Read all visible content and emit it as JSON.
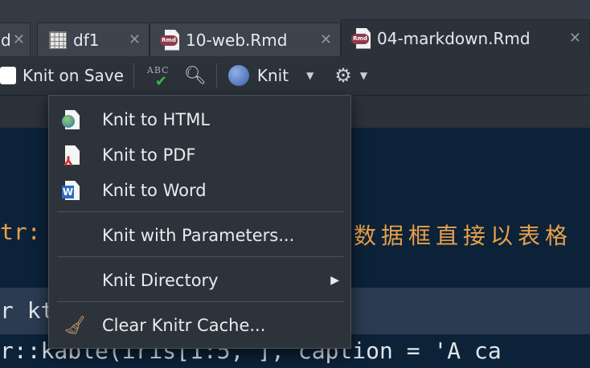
{
  "tabs": [
    {
      "label": "d",
      "icon": "none"
    },
    {
      "label": "df1",
      "icon": "grid-icon"
    },
    {
      "label": "10-web.Rmd",
      "icon": "rmd-file-icon"
    },
    {
      "label": "04-markdown.Rmd",
      "icon": "rmd-file-icon",
      "active": true
    }
  ],
  "tab_icon_badge": "Rmd",
  "toolbar": {
    "knit_on_save": "Knit on Save",
    "spell_text": "ABC",
    "knit": "Knit"
  },
  "editor": {
    "line1_prefix": "tr:",
    "line1_chinese": "数据框直接以表格",
    "line2": "r kt",
    "line3": "r::kable(iris[1:5, ], caption = 'A ca"
  },
  "menu": {
    "items": [
      {
        "label": "Knit to HTML",
        "icon": "html-globe-icon"
      },
      {
        "label": "Knit to PDF",
        "icon": "pdf-icon"
      },
      {
        "label": "Knit to Word",
        "icon": "word-icon"
      },
      {
        "label": "Knit with Parameters...",
        "icon": "none"
      },
      {
        "label": "Knit Directory",
        "icon": "none",
        "submenu": true
      },
      {
        "label": "Clear Knitr Cache...",
        "icon": "broom-icon"
      }
    ]
  },
  "colors": {
    "editor_bg": "#0c2238",
    "toolbar_bg": "#2b323a",
    "menu_bg": "#2d333a",
    "string_color": "#e8a04a",
    "rmd_badge": "#8f3a4c"
  }
}
